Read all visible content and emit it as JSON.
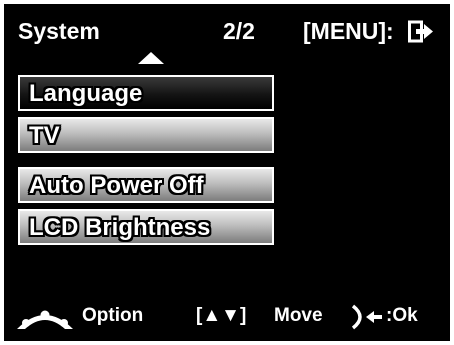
{
  "header": {
    "title": "System",
    "page": "2/2",
    "menu_hint": "[MENU]:"
  },
  "menu": {
    "items": [
      {
        "label": "Language",
        "selected": true
      },
      {
        "label": "TV",
        "selected": false
      },
      {
        "label": "Auto Power Off",
        "selected": false
      },
      {
        "label": "LCD Brightness",
        "selected": false
      }
    ]
  },
  "footer": {
    "option_label": "Option",
    "move_brackets": "[▲▼]",
    "move_label": "Move",
    "ok_label": ":Ok"
  },
  "icons": {
    "exit": "exit-icon",
    "scroll_up": "up-arrow-icon",
    "option": "option-dial-icon",
    "ok": "shutter-button-icon"
  },
  "colors": {
    "background": "#000000",
    "text": "#ffffff",
    "item_light": "#bdbdbd",
    "item_selected": "#000000"
  }
}
